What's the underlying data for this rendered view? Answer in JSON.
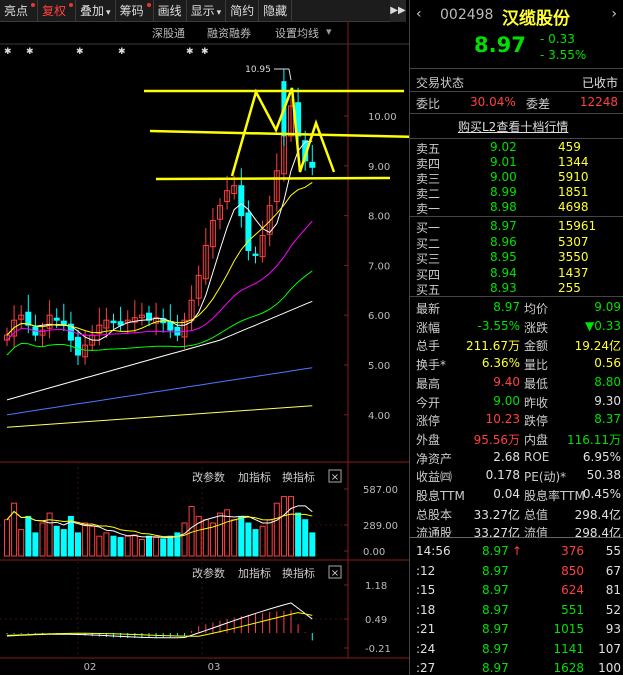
{
  "toolbar": {
    "items": [
      {
        "label": "亮点",
        "red": false,
        "dot": true
      },
      {
        "label": "复权",
        "red": true,
        "dot": true
      },
      {
        "label": "叠加",
        "red": false,
        "dot": false,
        "arrow": true
      },
      {
        "label": "筹码",
        "red": false,
        "dot": true
      },
      {
        "label": "画线",
        "red": false,
        "dot": false
      },
      {
        "label": "显示",
        "red": false,
        "dot": false,
        "arrow": true
      },
      {
        "label": "简约",
        "red": false,
        "dot": false
      },
      {
        "label": "隐藏",
        "red": false,
        "dot": false
      }
    ],
    "more": "▶▶"
  },
  "subbar": {
    "item1": "深股通",
    "item2": "融资融券",
    "item3": "设置均线",
    "arrow": "▾"
  },
  "main_chart": {
    "price_axis": [
      "10.00",
      "9.00",
      "8.00",
      "7.00",
      "6.00",
      "5.00",
      "4.00"
    ],
    "high_label": "10.95",
    "colors": {
      "up": "#ff4040",
      "down": "#00ffff",
      "ma5": "#ffffff",
      "ma10": "#ffff00",
      "ma20": "#ff00ff",
      "ma30": "#00ff00",
      "ma60": "#ffffff",
      "ma120": "#4a7aff",
      "ma250": "#ffff66",
      "drawing": "#ffff00"
    }
  },
  "volume_panel": {
    "btn1": "改参数",
    "btn2": "加指标",
    "btn3": "换指标",
    "close": "×",
    "axis": [
      "587.00",
      "289.00",
      "0.00"
    ]
  },
  "macd_panel": {
    "btn1": "改参数",
    "btn2": "加指标",
    "btn3": "换指标",
    "close": "×",
    "axis": [
      "1.18",
      "0.49",
      "-0.21"
    ]
  },
  "date_axis": [
    "02",
    "03"
  ],
  "quote": {
    "code": "002498",
    "name": "汉缆股份",
    "price": "8.97",
    "change": "- 0.33",
    "change_pct": "- 3.55%",
    "status_label": "交易状态",
    "status_value": "已收市",
    "weibi_label": "委比",
    "weibi_value": "30.04%",
    "weicha_label": "委差",
    "weicha_value": "12248",
    "level10_link": "购买L2查看十档行情"
  },
  "asks": [
    {
      "label": "卖五",
      "price": "9.02",
      "vol": "459"
    },
    {
      "label": "卖四",
      "price": "9.01",
      "vol": "1344"
    },
    {
      "label": "卖三",
      "price": "9.00",
      "vol": "5910"
    },
    {
      "label": "卖二",
      "price": "8.99",
      "vol": "1851"
    },
    {
      "label": "卖一",
      "price": "8.98",
      "vol": "4698"
    }
  ],
  "bids": [
    {
      "label": "买一",
      "price": "8.97",
      "vol": "15961"
    },
    {
      "label": "买二",
      "price": "8.96",
      "vol": "5307"
    },
    {
      "label": "买三",
      "price": "8.95",
      "vol": "3550"
    },
    {
      "label": "买四",
      "price": "8.94",
      "vol": "1437"
    },
    {
      "label": "买五",
      "price": "8.93",
      "vol": "255"
    }
  ],
  "stats": [
    {
      "l1": "最新",
      "v1": "8.97",
      "c1": "dn",
      "l2": "均价",
      "v2": "9.09",
      "c2": "dn"
    },
    {
      "l1": "涨幅",
      "v1": "-3.55%",
      "c1": "dn",
      "l2": "涨跌",
      "v2": "▼0.33",
      "c2": "dn"
    },
    {
      "l1": "总手",
      "v1": "211.67万",
      "c1": "yl",
      "l2": "金额",
      "v2": "19.24亿",
      "c2": "yl"
    },
    {
      "l1": "换手*",
      "v1": "6.36%",
      "c1": "yl",
      "l2": "量比",
      "v2": "0.56",
      "c2": "yl"
    },
    {
      "l1": "最高",
      "v1": "9.40",
      "c1": "up",
      "l2": "最低",
      "v2": "8.80",
      "c2": "dn"
    },
    {
      "l1": "今开",
      "v1": "9.00",
      "c1": "dn",
      "l2": "昨收",
      "v2": "9.30",
      "c2": "wt"
    },
    {
      "l1": "涨停",
      "v1": "10.23",
      "c1": "up",
      "l2": "跌停",
      "v2": "8.37",
      "c2": "dn"
    },
    {
      "l1": "外盘",
      "v1": "95.56万",
      "c1": "up",
      "l2": "内盘",
      "v2": "116.11万",
      "c2": "dn"
    },
    {
      "l1": "净资产",
      "v1": "2.68",
      "c1": "wt",
      "l2": "ROE",
      "v2": "6.95%",
      "c2": "wt"
    },
    {
      "l1": "收益㈣",
      "v1": "0.178",
      "c1": "wt",
      "l2": "PE(动)*",
      "v2": "50.38",
      "c2": "wt"
    },
    {
      "l1": "股息TTM",
      "v1": "0.04",
      "c1": "wt",
      "l2": "股息率TTM",
      "v2": "0.45%",
      "c2": "wt"
    },
    {
      "l1": "总股本",
      "v1": "33.27亿",
      "c1": "wt",
      "l2": "总值",
      "v2": "298.4亿",
      "c2": "wt"
    },
    {
      "l1": "流通股",
      "v1": "33.27亿",
      "c1": "wt",
      "l2": "流值",
      "v2": "298.4亿",
      "c2": "wt"
    }
  ],
  "ticks": [
    {
      "time": "14:56",
      "price": "8.97",
      "arrow": "↑",
      "vol": "376",
      "num": "55",
      "vc": "up"
    },
    {
      "time": ":12",
      "price": "8.97",
      "arrow": "",
      "vol": "850",
      "num": "67",
      "vc": "up"
    },
    {
      "time": ":15",
      "price": "8.97",
      "arrow": "",
      "vol": "624",
      "num": "81",
      "vc": "up"
    },
    {
      "time": ":18",
      "price": "8.97",
      "arrow": "",
      "vol": "551",
      "num": "52",
      "vc": "dn"
    },
    {
      "time": ":21",
      "price": "8.97",
      "arrow": "",
      "vol": "1015",
      "num": "93",
      "vc": "dn"
    },
    {
      "time": ":24",
      "price": "8.97",
      "arrow": "",
      "vol": "1141",
      "num": "107",
      "vc": "dn"
    },
    {
      "time": ":27",
      "price": "8.97",
      "arrow": "",
      "vol": "1628",
      "num": "100",
      "vc": "dn"
    }
  ]
}
